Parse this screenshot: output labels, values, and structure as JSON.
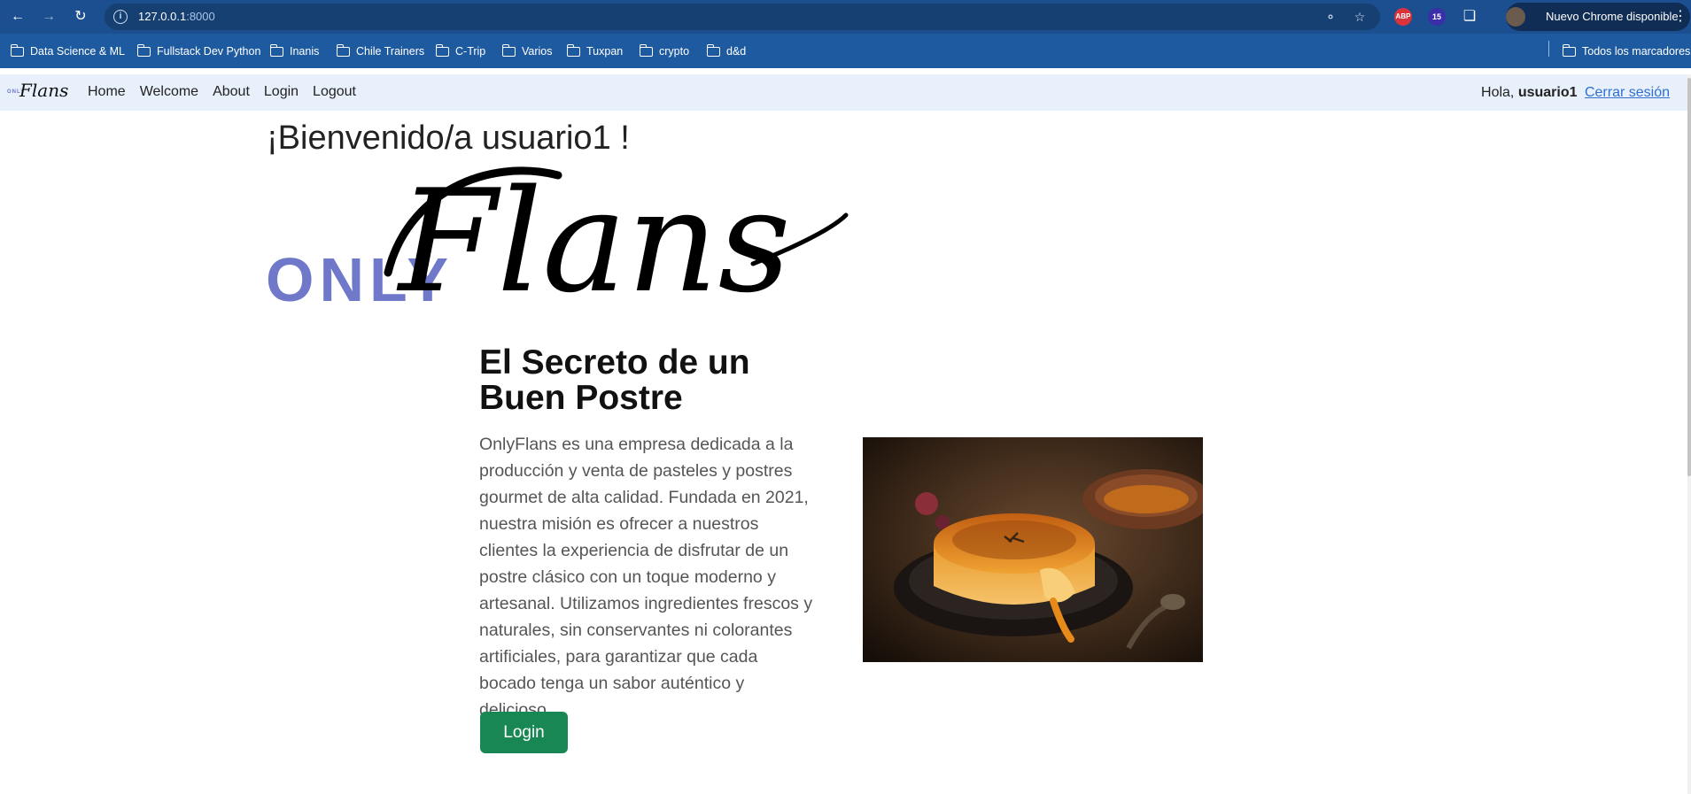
{
  "browser": {
    "url_host": "127.0.0.1",
    "url_port": ":8000",
    "chrome_pill": "Nuevo Chrome disponible",
    "ext_abp": "ABP",
    "ext_badge": "15"
  },
  "bookmarks": [
    {
      "label": "Data Science & ML"
    },
    {
      "label": "Fullstack Dev Python"
    },
    {
      "label": "Inanis"
    },
    {
      "label": "Chile Trainers"
    },
    {
      "label": "C-Trip"
    },
    {
      "label": "Varios"
    },
    {
      "label": "Tuxpan"
    },
    {
      "label": "crypto"
    },
    {
      "label": "d&d"
    }
  ],
  "bookmarks_all": "Todos los marcadores",
  "site": {
    "brand_only": "ONLY",
    "brand_flans": "Flans",
    "nav": [
      "Home",
      "Welcome",
      "About",
      "Login",
      "Logout"
    ],
    "greeting": "Hola,",
    "username": "usuario1",
    "logout_link": "Cerrar sesión"
  },
  "main": {
    "welcome": "¡Bienvenido/a usuario1 !",
    "logo_only": "ONLY",
    "logo_flans": "Flans",
    "headline": "El Secreto de un Buen Postre",
    "paragraph": "OnlyFlans es una empresa dedicada a la producción y venta de pasteles y postres gourmet de alta calidad. Fundada en 2021, nuestra misión es ofrecer a nuestros clientes la experiencia de disfrutar de un postre clásico con un toque moderno y artesanal. Utilizamos ingredientes frescos y naturales, sin conservantes ni colorantes artificiales, para garantizar que cada bocado tenga un sabor auténtico y delicioso.",
    "login_button": "Login"
  },
  "colors": {
    "chrome_bg": "#1e5aa0",
    "nav_bg": "#e8f1fb",
    "logo_only": "#6f78c9",
    "button_green": "#198754",
    "link_blue": "#2f6fd1"
  }
}
